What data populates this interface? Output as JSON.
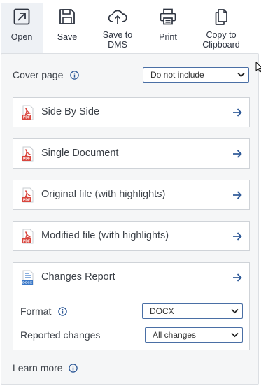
{
  "toolbar": {
    "items": [
      {
        "label": "Open",
        "icon": "open-external-icon"
      },
      {
        "label": "Save",
        "icon": "floppy-disk-icon"
      },
      {
        "label_line1": "Save to",
        "label_line2": "DMS",
        "icon": "cloud-upload-icon"
      },
      {
        "label": "Print",
        "icon": "printer-icon"
      },
      {
        "label_line1": "Copy to",
        "label_line2": "Clipboard",
        "icon": "clipboard-copy-icon"
      }
    ]
  },
  "cover_page": {
    "label": "Cover page",
    "selected": "Do not include"
  },
  "outputs": [
    {
      "title": "Side By Side",
      "icon": "pdf-file-icon"
    },
    {
      "title": "Single Document",
      "icon": "pdf-file-icon"
    },
    {
      "title": "Original file (with highlights)",
      "icon": "pdf-file-icon"
    },
    {
      "title": "Modified file (with highlights)",
      "icon": "pdf-file-icon"
    }
  ],
  "changes_report": {
    "title": "Changes Report",
    "icon": "docx-file-icon",
    "format_label": "Format",
    "format_value": "DOCX",
    "reported_label": "Reported changes",
    "reported_value": "All changes"
  },
  "learn_more": "Learn more",
  "colors": {
    "accent": "#2b5796",
    "pdf_red": "#d9463e",
    "docx_blue": "#3a78c8",
    "panel_bg": "#f5f6f7"
  }
}
